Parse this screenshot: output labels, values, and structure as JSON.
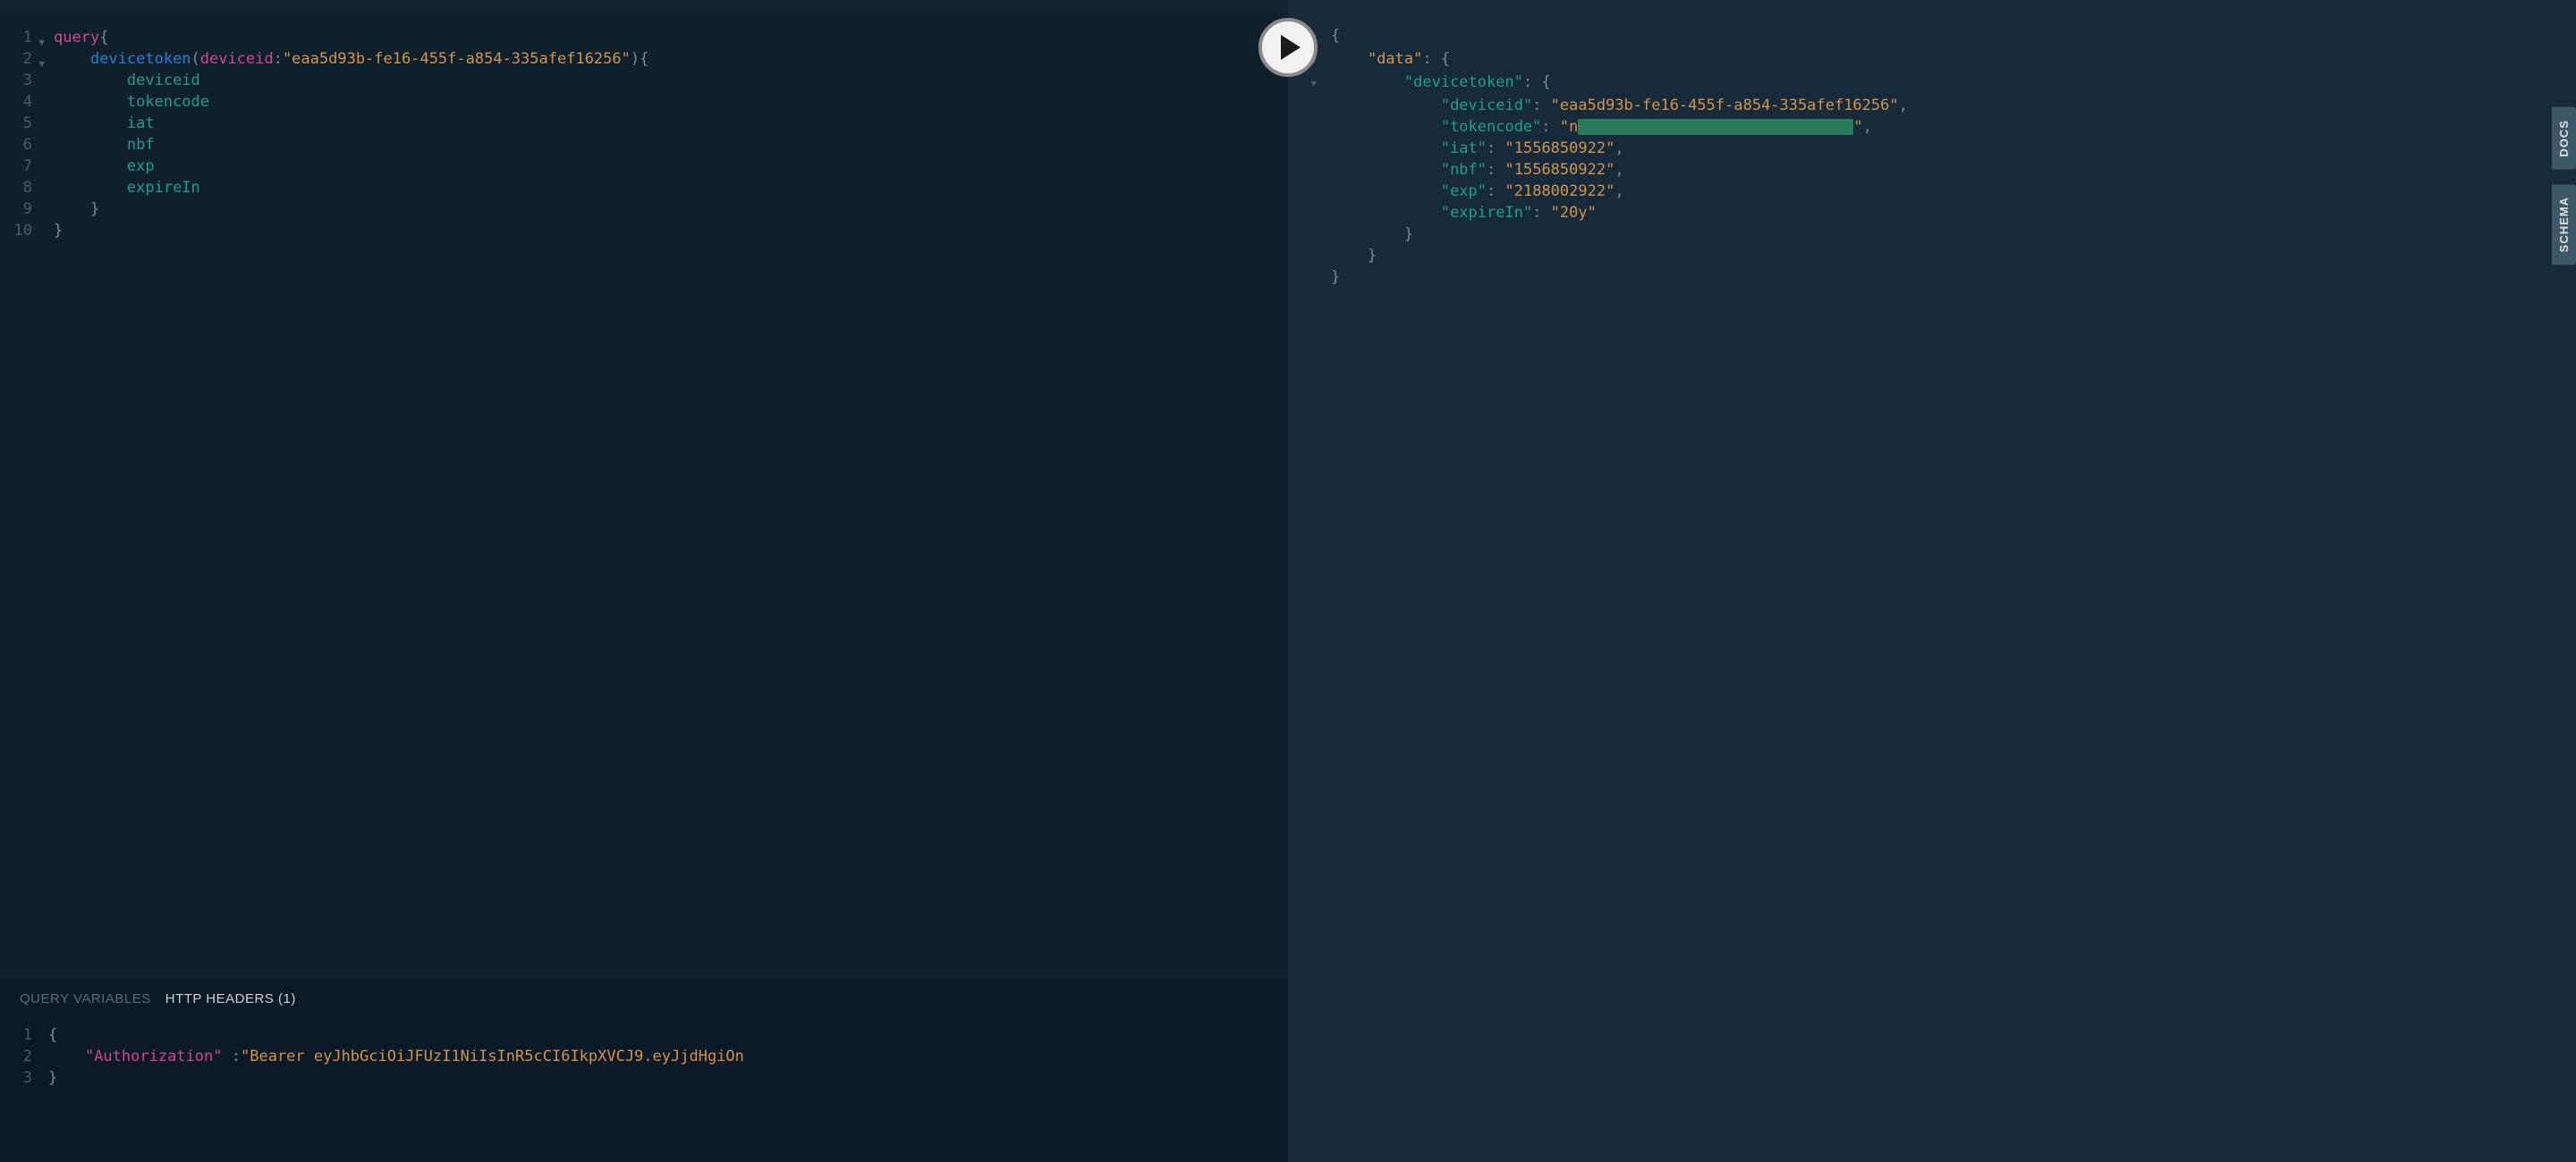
{
  "query_editor": {
    "lines": [
      {
        "n": "1",
        "fold": true,
        "tokens": [
          {
            "t": "query",
            "c": "tok-keyword"
          },
          {
            "t": "{",
            "c": "tok-brace"
          }
        ]
      },
      {
        "n": "2",
        "fold": true,
        "indent": 2,
        "tokens": [
          {
            "t": "devicetoken",
            "c": "tok-field"
          },
          {
            "t": "(",
            "c": "tok-punct"
          },
          {
            "t": "deviceid",
            "c": "tok-arg"
          },
          {
            "t": ":",
            "c": "tok-punct"
          },
          {
            "t": "\"eaa5d93b-fe16-455f-a854-335afef16256\"",
            "c": "tok-string"
          },
          {
            "t": ")",
            "c": "tok-punct"
          },
          {
            "t": "{",
            "c": "tok-brace"
          }
        ]
      },
      {
        "n": "3",
        "indent": 4,
        "tokens": [
          {
            "t": "deviceid",
            "c": "tok-prop"
          }
        ]
      },
      {
        "n": "4",
        "indent": 4,
        "tokens": [
          {
            "t": "tokencode",
            "c": "tok-prop"
          }
        ]
      },
      {
        "n": "5",
        "indent": 4,
        "tokens": [
          {
            "t": "iat",
            "c": "tok-prop"
          }
        ]
      },
      {
        "n": "6",
        "indent": 4,
        "tokens": [
          {
            "t": "nbf",
            "c": "tok-prop"
          }
        ]
      },
      {
        "n": "7",
        "indent": 4,
        "tokens": [
          {
            "t": "exp",
            "c": "tok-prop"
          }
        ]
      },
      {
        "n": "8",
        "indent": 4,
        "tokens": [
          {
            "t": "expireIn",
            "c": "tok-prop"
          }
        ]
      },
      {
        "n": "9",
        "indent": 2,
        "tokens": [
          {
            "t": "}",
            "c": "tok-brace"
          }
        ]
      },
      {
        "n": "10",
        "indent": 0,
        "tokens": [
          {
            "t": "}",
            "c": "tok-brace"
          }
        ]
      }
    ]
  },
  "bottom_panel": {
    "tab_variables_label": "QUERY VARIABLES",
    "tab_headers_label": "HTTP HEADERS (1)",
    "active_tab": "headers",
    "headers_lines": [
      {
        "n": "1",
        "indent": 0,
        "tokens": [
          {
            "t": "{",
            "c": "tok-brace"
          }
        ]
      },
      {
        "n": "2",
        "indent": 2,
        "tokens": [
          {
            "t": "\"Authorization\"",
            "c": "tok-arg"
          },
          {
            "t": " ",
            "c": ""
          },
          {
            "t": ":",
            "c": "tok-punct"
          },
          {
            "t": "\"Bearer eyJhbGciOiJFUzI1NiIsInR5cCI6IkpXVCJ9.eyJjdHgiOn",
            "c": "tok-string"
          }
        ]
      },
      {
        "n": "3",
        "indent": 0,
        "tokens": [
          {
            "t": "}",
            "c": "tok-brace"
          }
        ]
      }
    ]
  },
  "result": {
    "lines": [
      {
        "fold": true,
        "indent": 0,
        "tokens": [
          {
            "t": "{",
            "c": "r-brace"
          }
        ]
      },
      {
        "fold": true,
        "indent": 2,
        "tokens": [
          {
            "t": "\"data\"",
            "c": "r-string",
            "datakey": true
          },
          {
            "t": ": ",
            "c": "r-punct"
          },
          {
            "t": "{",
            "c": "r-brace"
          }
        ]
      },
      {
        "fold": true,
        "indent": 4,
        "tokens": [
          {
            "t": "\"devicetoken\"",
            "c": "r-key"
          },
          {
            "t": ": ",
            "c": "r-punct"
          },
          {
            "t": "{",
            "c": "r-brace"
          }
        ]
      },
      {
        "indent": 6,
        "tokens": [
          {
            "t": "\"deviceid\"",
            "c": "r-key"
          },
          {
            "t": ": ",
            "c": "r-punct"
          },
          {
            "t": "\"eaa5d93b-fe16-455f-a854-335afef16256\"",
            "c": "r-string"
          },
          {
            "t": ",",
            "c": "r-punct"
          }
        ]
      },
      {
        "indent": 6,
        "tokens": [
          {
            "t": "\"tokencode\"",
            "c": "r-key"
          },
          {
            "t": ": ",
            "c": "r-punct"
          },
          {
            "t": "\"n",
            "c": "r-string"
          },
          {
            "redacted": true
          },
          {
            "t": "\"",
            "c": "r-string"
          },
          {
            "t": ",",
            "c": "r-punct"
          }
        ]
      },
      {
        "indent": 6,
        "tokens": [
          {
            "t": "\"iat\"",
            "c": "r-key"
          },
          {
            "t": ": ",
            "c": "r-punct"
          },
          {
            "t": "\"1556850922\"",
            "c": "r-string"
          },
          {
            "t": ",",
            "c": "r-punct"
          }
        ]
      },
      {
        "indent": 6,
        "tokens": [
          {
            "t": "\"nbf\"",
            "c": "r-key"
          },
          {
            "t": ": ",
            "c": "r-punct"
          },
          {
            "t": "\"1556850922\"",
            "c": "r-string"
          },
          {
            "t": ",",
            "c": "r-punct"
          }
        ]
      },
      {
        "indent": 6,
        "tokens": [
          {
            "t": "\"exp\"",
            "c": "r-key"
          },
          {
            "t": ": ",
            "c": "r-punct"
          },
          {
            "t": "\"2188002922\"",
            "c": "r-string"
          },
          {
            "t": ",",
            "c": "r-punct"
          }
        ]
      },
      {
        "indent": 6,
        "tokens": [
          {
            "t": "\"expireIn\"",
            "c": "r-key"
          },
          {
            "t": ": ",
            "c": "r-punct"
          },
          {
            "t": "\"20y\"",
            "c": "r-string"
          }
        ]
      },
      {
        "indent": 4,
        "tokens": [
          {
            "t": "}",
            "c": "r-brace"
          }
        ]
      },
      {
        "indent": 2,
        "tokens": [
          {
            "t": "}",
            "c": "r-brace"
          }
        ]
      },
      {
        "indent": 0,
        "tokens": [
          {
            "t": "}",
            "c": "r-brace"
          }
        ]
      }
    ]
  },
  "side_tabs": {
    "docs_label": "DOCS",
    "schema_label": "SCHEMA"
  }
}
